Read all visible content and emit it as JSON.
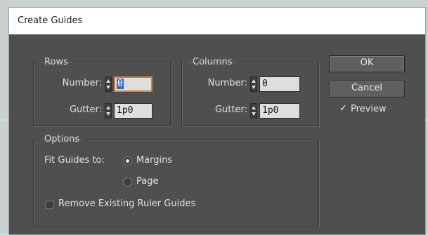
{
  "window": {
    "title": "Create Guides"
  },
  "rows": {
    "legend": "Rows",
    "number_label": "Number:",
    "number_value": "0",
    "gutter_label": "Gutter:",
    "gutter_value": "1p0"
  },
  "columns": {
    "legend": "Columns",
    "number_label": "Number:",
    "number_value": "0",
    "gutter_label": "Gutter:",
    "gutter_value": "1p0"
  },
  "options": {
    "legend": "Options",
    "fit_label": "Fit Guides to:",
    "fit_options": [
      "Margins",
      "Page"
    ],
    "fit_selected": "Margins",
    "remove_label": "Remove Existing Ruler Guides",
    "remove_checked": false
  },
  "buttons": {
    "ok": "OK",
    "cancel": "Cancel"
  },
  "preview": {
    "label": "Preview",
    "checked": true
  },
  "icons": {
    "spinner": "up-down-arrows-icon",
    "checkmark": "check-icon",
    "radio": "radio-dot-icon"
  },
  "colors": {
    "panel_bg": "#4f4f4f",
    "field_bg": "#dedede",
    "focus_ring": "#d9822b",
    "selection": "#2d6bd6",
    "titlebar_bg": "#ffffff"
  }
}
